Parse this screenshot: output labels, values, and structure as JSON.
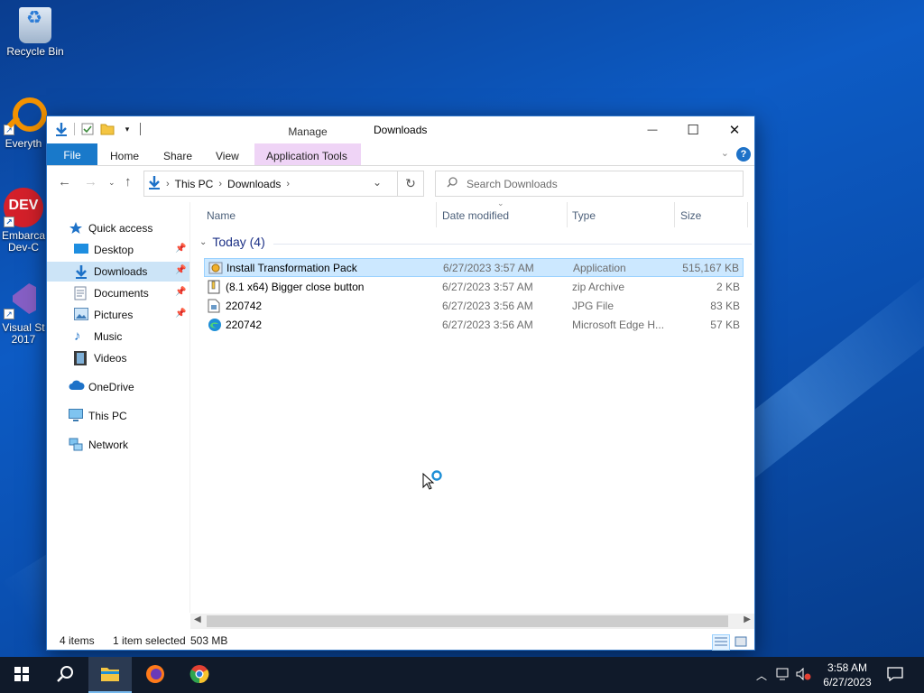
{
  "desktop": {
    "icons": [
      {
        "label": "Recycle Bin"
      },
      {
        "label": "Everyth"
      },
      {
        "label": "Embarca Dev-C"
      },
      {
        "label": "Visual St 2017"
      }
    ]
  },
  "window": {
    "title": "Downloads",
    "contextual_tab": "Manage",
    "controls": {
      "minimize": "—",
      "maximize": "☐",
      "close": "✕"
    }
  },
  "ribbon": {
    "tabs": [
      "File",
      "Home",
      "Share",
      "View",
      "Application Tools"
    ],
    "help": "?"
  },
  "address": {
    "crumbs": [
      "This PC",
      "Downloads"
    ],
    "search_placeholder": "Search Downloads"
  },
  "nav": {
    "quick_access": "Quick access",
    "items": [
      {
        "label": "Desktop",
        "pinned": true
      },
      {
        "label": "Downloads",
        "pinned": true,
        "selected": true
      },
      {
        "label": "Documents",
        "pinned": true
      },
      {
        "label": "Pictures",
        "pinned": true
      },
      {
        "label": "Music",
        "pinned": false
      },
      {
        "label": "Videos",
        "pinned": false
      }
    ],
    "onedrive": "OneDrive",
    "this_pc": "This PC",
    "network": "Network"
  },
  "columns": [
    "Name",
    "Date modified",
    "Type",
    "Size"
  ],
  "group": {
    "label": "Today (4)"
  },
  "files": [
    {
      "name": "Install Transformation Pack",
      "date": "6/27/2023 3:57 AM",
      "type": "Application",
      "size": "515,167 KB",
      "selected": true
    },
    {
      "name": "(8.1 x64) Bigger close button",
      "date": "6/27/2023 3:57 AM",
      "type": "zip Archive",
      "size": "2 KB"
    },
    {
      "name": "220742",
      "date": "6/27/2023 3:56 AM",
      "type": "JPG File",
      "size": "83 KB"
    },
    {
      "name": "220742",
      "date": "6/27/2023 3:56 AM",
      "type": "Microsoft Edge H...",
      "size": "57 KB"
    }
  ],
  "status": {
    "items": "4 items",
    "selected": "1 item selected",
    "size": "503 MB"
  },
  "taskbar": {
    "time": "3:58 AM",
    "date": "6/27/2023"
  },
  "colors": {
    "accent": "#1979ca",
    "selection": "#cce8ff",
    "manage_tab": "#efd4f6",
    "taskbar": "#101a2a"
  }
}
